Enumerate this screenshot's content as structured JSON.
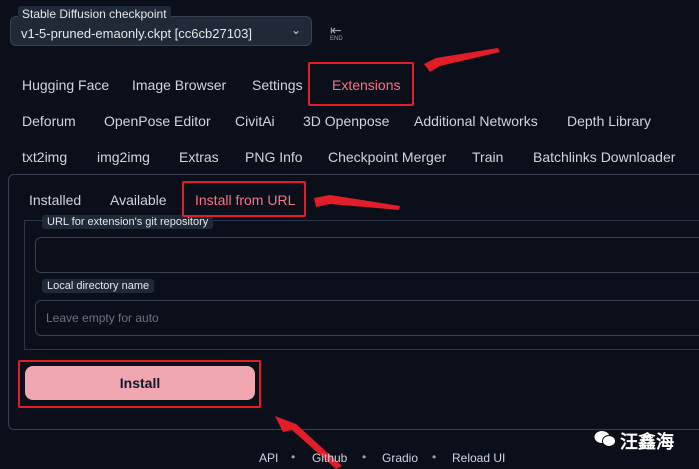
{
  "checkpoint": {
    "label": "Stable Diffusion checkpoint",
    "value": "v1-5-pruned-emaonly.ckpt [cc6cb27103]"
  },
  "end_button_text": "END",
  "tabs_row1": [
    "Hugging Face",
    "Image Browser",
    "Settings",
    "Extensions"
  ],
  "tabs_row2": [
    "Deforum",
    "OpenPose Editor",
    "CivitAi",
    "3D Openpose",
    "Additional Networks",
    "Depth Library"
  ],
  "tabs_row3": [
    "txt2img",
    "img2img",
    "Extras",
    "PNG Info",
    "Checkpoint Merger",
    "Train",
    "Batchlinks Downloader"
  ],
  "subtabs": [
    "Installed",
    "Available",
    "Install from URL"
  ],
  "form": {
    "url_label": "URL for extension's git repository",
    "url_value": "",
    "dir_label": "Local directory name",
    "dir_placeholder": "Leave empty for auto"
  },
  "install_button": "Install",
  "footer": [
    "API",
    "Github",
    "Gradio",
    "Reload UI"
  ],
  "watermark": "汪鑫海",
  "colors": {
    "background": "#0b0f19",
    "accent": "#fb7185",
    "button": "#f1a7b2",
    "annotation": "#e11d2a"
  }
}
